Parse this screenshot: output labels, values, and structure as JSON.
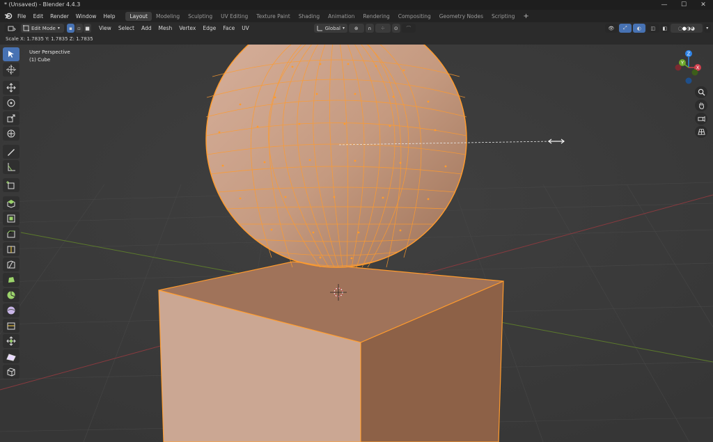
{
  "window": {
    "title": "* (Unsaved) - Blender 4.4.3",
    "controls": [
      "—",
      "☐",
      "✕"
    ]
  },
  "menu": {
    "items": [
      "File",
      "Edit",
      "Render",
      "Window",
      "Help"
    ]
  },
  "workspaces": {
    "tabs": [
      "Layout",
      "Modeling",
      "Sculpting",
      "UV Editing",
      "Texture Paint",
      "Shading",
      "Animation",
      "Rendering",
      "Compositing",
      "Geometry Nodes",
      "Scripting"
    ],
    "active": "Layout",
    "add_label": "+"
  },
  "header": {
    "mode": "Edit Mode",
    "menus": [
      "View",
      "Select",
      "Add",
      "Mesh",
      "Vertex",
      "Edge",
      "Face",
      "UV"
    ],
    "transform_orientation": "Global"
  },
  "operator_status": "Scale X: 1.7835   Y: 1.7835   Z: 1.7835",
  "viewport": {
    "view_name": "User Perspective",
    "object_name": "(1) Cube"
  },
  "gizmo": {
    "axes": [
      "X",
      "Y",
      "Z"
    ]
  },
  "colors": {
    "accent": "#4772b3",
    "selection": "#ff9b2d",
    "x_axis": "#d0404e",
    "y_axis": "#6ca82a",
    "z_axis": "#2f84e8"
  }
}
